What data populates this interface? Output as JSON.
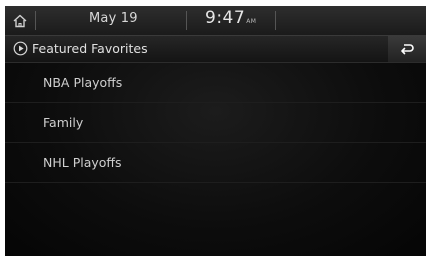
{
  "status_bar": {
    "date": "May 19",
    "time": "9:47",
    "ampm": "AM",
    "home_icon": "home-icon"
  },
  "header": {
    "title": "Featured Favorites",
    "title_icon": "play-circle-icon",
    "back_icon": "back-arrow-icon"
  },
  "favorites": {
    "items": [
      {
        "label": "NBA Playoffs"
      },
      {
        "label": "Family"
      },
      {
        "label": "NHL Playoffs"
      }
    ]
  },
  "colors": {
    "background": "#000000",
    "text": "#cfcfcf"
  }
}
